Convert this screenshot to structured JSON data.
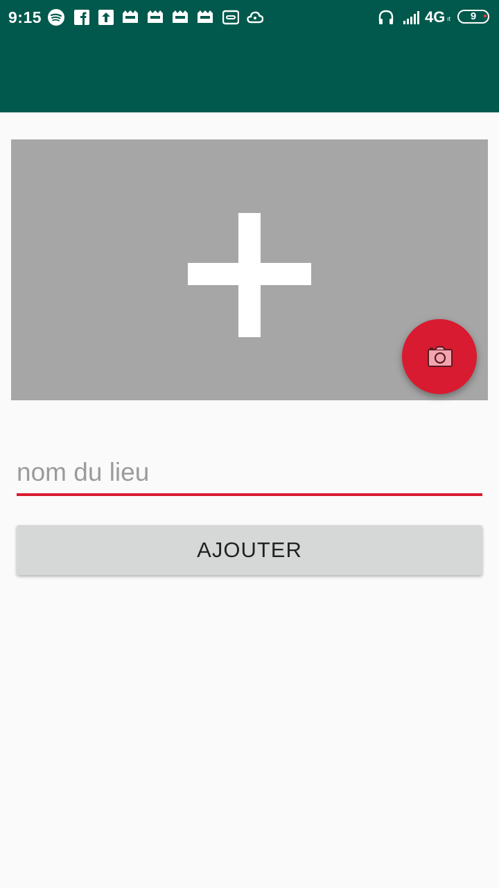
{
  "status_bar": {
    "time": "9:15",
    "network": "4G",
    "network_sub": "ıt",
    "battery_level": "9",
    "notification_icons": [
      "spotify-icon",
      "facebook-icon",
      "upload-icon",
      "app-icon",
      "app-icon",
      "app-icon",
      "app-icon",
      "voicemail-icon",
      "cloud-icon"
    ]
  },
  "colors": {
    "primary": "#00594c",
    "accent": "#d81b30",
    "image_placeholder": "#a6a6a6",
    "button": "#d6d7d7",
    "background": "#fafafa"
  },
  "form": {
    "name_placeholder": "nom du lieu",
    "name_value": "",
    "add_button_label": "AJOUTER"
  }
}
